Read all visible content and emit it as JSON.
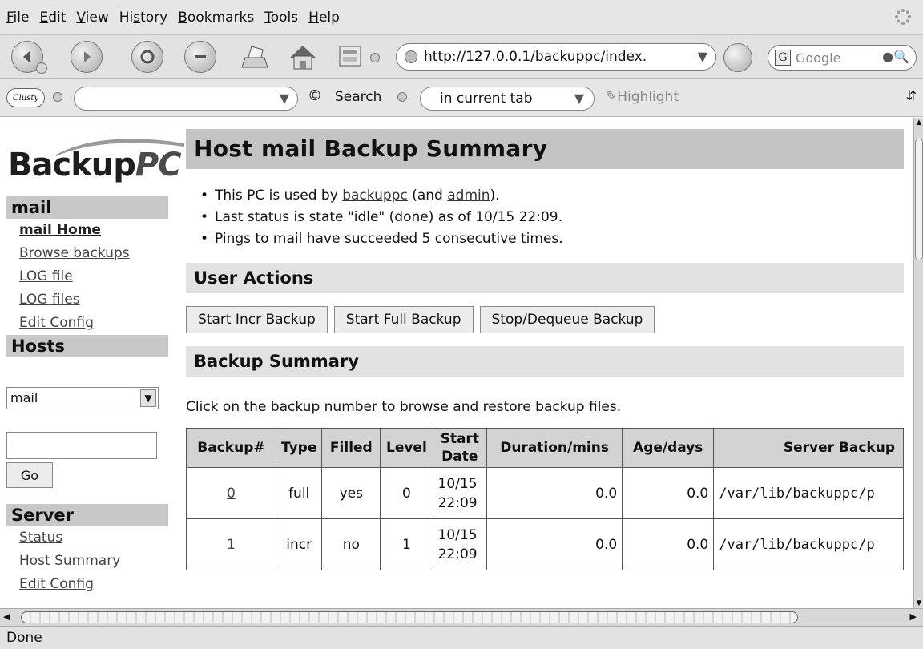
{
  "menubar": {
    "items": [
      {
        "label": "File",
        "accel": "F"
      },
      {
        "label": "Edit",
        "accel": "E"
      },
      {
        "label": "View",
        "accel": "V"
      },
      {
        "label": "History",
        "accel": "s"
      },
      {
        "label": "Bookmarks",
        "accel": "B"
      },
      {
        "label": "Tools",
        "accel": "T"
      },
      {
        "label": "Help",
        "accel": "H"
      }
    ]
  },
  "navbar": {
    "url": "http://127.0.0.1/backuppc/index.",
    "search_engine": "Google"
  },
  "toolbar2": {
    "brand": "Clusty",
    "copyright_glyph": "©",
    "search_label": "Search",
    "tab_option": "in current tab",
    "highlight_label": "Highlight"
  },
  "logo": {
    "text_main": "Backup",
    "text_suffix": "PC"
  },
  "sidebar": {
    "host_section": "mail",
    "host_links": [
      "mail Home",
      "Browse backups",
      "LOG file",
      "LOG files",
      "Edit Config"
    ],
    "hosts_section": "Hosts",
    "host_select_value": "mail",
    "go_label": "Go",
    "server_section": "Server",
    "server_links": [
      "Status",
      "Host Summary",
      "Edit Config"
    ]
  },
  "main": {
    "title": "Host mail Backup Summary",
    "bullets": {
      "line1_prefix": "This PC is used by ",
      "line1_user": "backuppc",
      "line1_mid": " (and ",
      "line1_admin": "admin",
      "line1_suffix": ").",
      "line2": "Last status is state \"idle\" (done) as of 10/15 22:09.",
      "line3": "Pings to mail have succeeded 5 consecutive times."
    },
    "user_actions_heading": "User Actions",
    "actions": [
      "Start Incr Backup",
      "Start Full Backup",
      "Stop/Dequeue Backup"
    ],
    "backup_summary_heading": "Backup Summary",
    "summary_note": "Click on the backup number to browse and restore backup files.",
    "table": {
      "headers": [
        "Backup#",
        "Type",
        "Filled",
        "Level",
        "Start Date",
        "Duration/mins",
        "Age/days",
        "Server Backup"
      ],
      "header_start_line1": "Start",
      "header_start_line2": "Date",
      "rows": [
        {
          "num": "0",
          "type": "full",
          "filled": "yes",
          "level": "0",
          "date": "10/15",
          "time": "22:09",
          "duration": "0.0",
          "age": "0.0",
          "path": "/var/lib/backuppc/p"
        },
        {
          "num": "1",
          "type": "incr",
          "filled": "no",
          "level": "1",
          "date": "10/15",
          "time": "22:09",
          "duration": "0.0",
          "age": "0.0",
          "path": "/var/lib/backuppc/p"
        }
      ]
    }
  },
  "statusbar": {
    "text": "Done"
  },
  "colors": {
    "title_bar": "#c4c4c4",
    "section_bar": "#e2e2e2",
    "side_head": "#c8c8c8",
    "chrome": "#e6e6e6"
  }
}
